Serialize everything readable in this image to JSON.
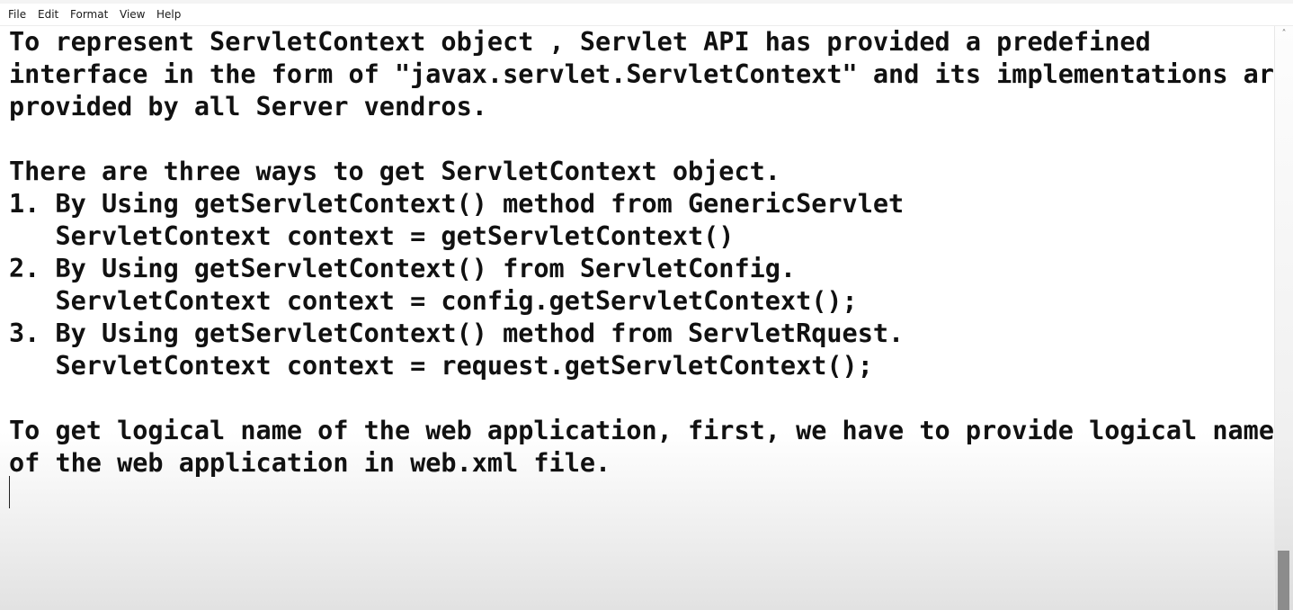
{
  "menubar": {
    "items": [
      "File",
      "Edit",
      "Format",
      "View",
      "Help"
    ]
  },
  "editor": {
    "lines": [
      "To represent ServletContext object , Servlet API has provided a predefined",
      "interface in the form of \"javax.servlet.ServletContext\" and its implementations are",
      "provided by all Server vendros.",
      "",
      "There are three ways to get ServletContext object.",
      "1. By Using getServletContext() method from GenericServlet",
      "   ServletContext context = getServletContext()",
      "2. By Using getServletContext() from ServletConfig.",
      "   ServletContext context = config.getServletContext();",
      "3. By Using getServletContext() method from ServletRquest.",
      "   ServletContext context = request.getServletContext();",
      "",
      "To get logical name of the web application, first, we have to provide logical name",
      "of the web application in web.xml file."
    ]
  },
  "scrollbar": {
    "up_arrow_icon": "chevron-up-icon"
  }
}
